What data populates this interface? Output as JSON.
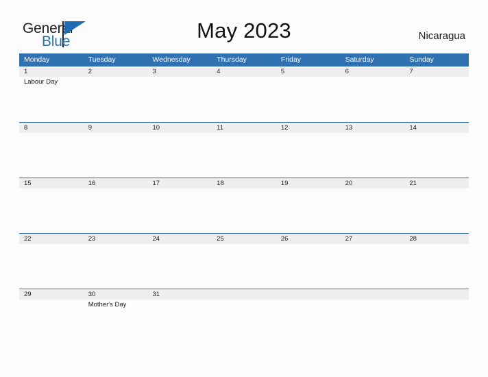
{
  "brand": {
    "name_part1": "General",
    "name_part2": "Blue",
    "flag_icon": "blue-triangle-flag-icon",
    "accent_color": "#2671b5"
  },
  "header": {
    "title": "May 2023",
    "region": "Nicaragua"
  },
  "calendar": {
    "month": "May",
    "year": "2023",
    "header_bg_color": "#3071b2",
    "band_bg_color": "#eeeeee",
    "weekdays": [
      "Monday",
      "Tuesday",
      "Wednesday",
      "Thursday",
      "Friday",
      "Saturday",
      "Sunday"
    ],
    "weeks": [
      {
        "days": [
          {
            "num": "1",
            "events": [
              "Labour Day"
            ]
          },
          {
            "num": "2",
            "events": []
          },
          {
            "num": "3",
            "events": []
          },
          {
            "num": "4",
            "events": []
          },
          {
            "num": "5",
            "events": []
          },
          {
            "num": "6",
            "events": []
          },
          {
            "num": "7",
            "events": []
          }
        ]
      },
      {
        "days": [
          {
            "num": "8",
            "events": []
          },
          {
            "num": "9",
            "events": []
          },
          {
            "num": "10",
            "events": []
          },
          {
            "num": "11",
            "events": []
          },
          {
            "num": "12",
            "events": []
          },
          {
            "num": "13",
            "events": []
          },
          {
            "num": "14",
            "events": []
          }
        ]
      },
      {
        "days": [
          {
            "num": "15",
            "events": []
          },
          {
            "num": "16",
            "events": []
          },
          {
            "num": "17",
            "events": []
          },
          {
            "num": "18",
            "events": []
          },
          {
            "num": "19",
            "events": []
          },
          {
            "num": "20",
            "events": []
          },
          {
            "num": "21",
            "events": []
          }
        ]
      },
      {
        "days": [
          {
            "num": "22",
            "events": []
          },
          {
            "num": "23",
            "events": []
          },
          {
            "num": "24",
            "events": []
          },
          {
            "num": "25",
            "events": []
          },
          {
            "num": "26",
            "events": []
          },
          {
            "num": "27",
            "events": []
          },
          {
            "num": "28",
            "events": []
          }
        ]
      },
      {
        "days": [
          {
            "num": "29",
            "events": []
          },
          {
            "num": "30",
            "events": [
              "Mother's Day"
            ]
          },
          {
            "num": "31",
            "events": []
          },
          {
            "num": "",
            "events": []
          },
          {
            "num": "",
            "events": []
          },
          {
            "num": "",
            "events": []
          },
          {
            "num": "",
            "events": []
          }
        ]
      }
    ]
  }
}
